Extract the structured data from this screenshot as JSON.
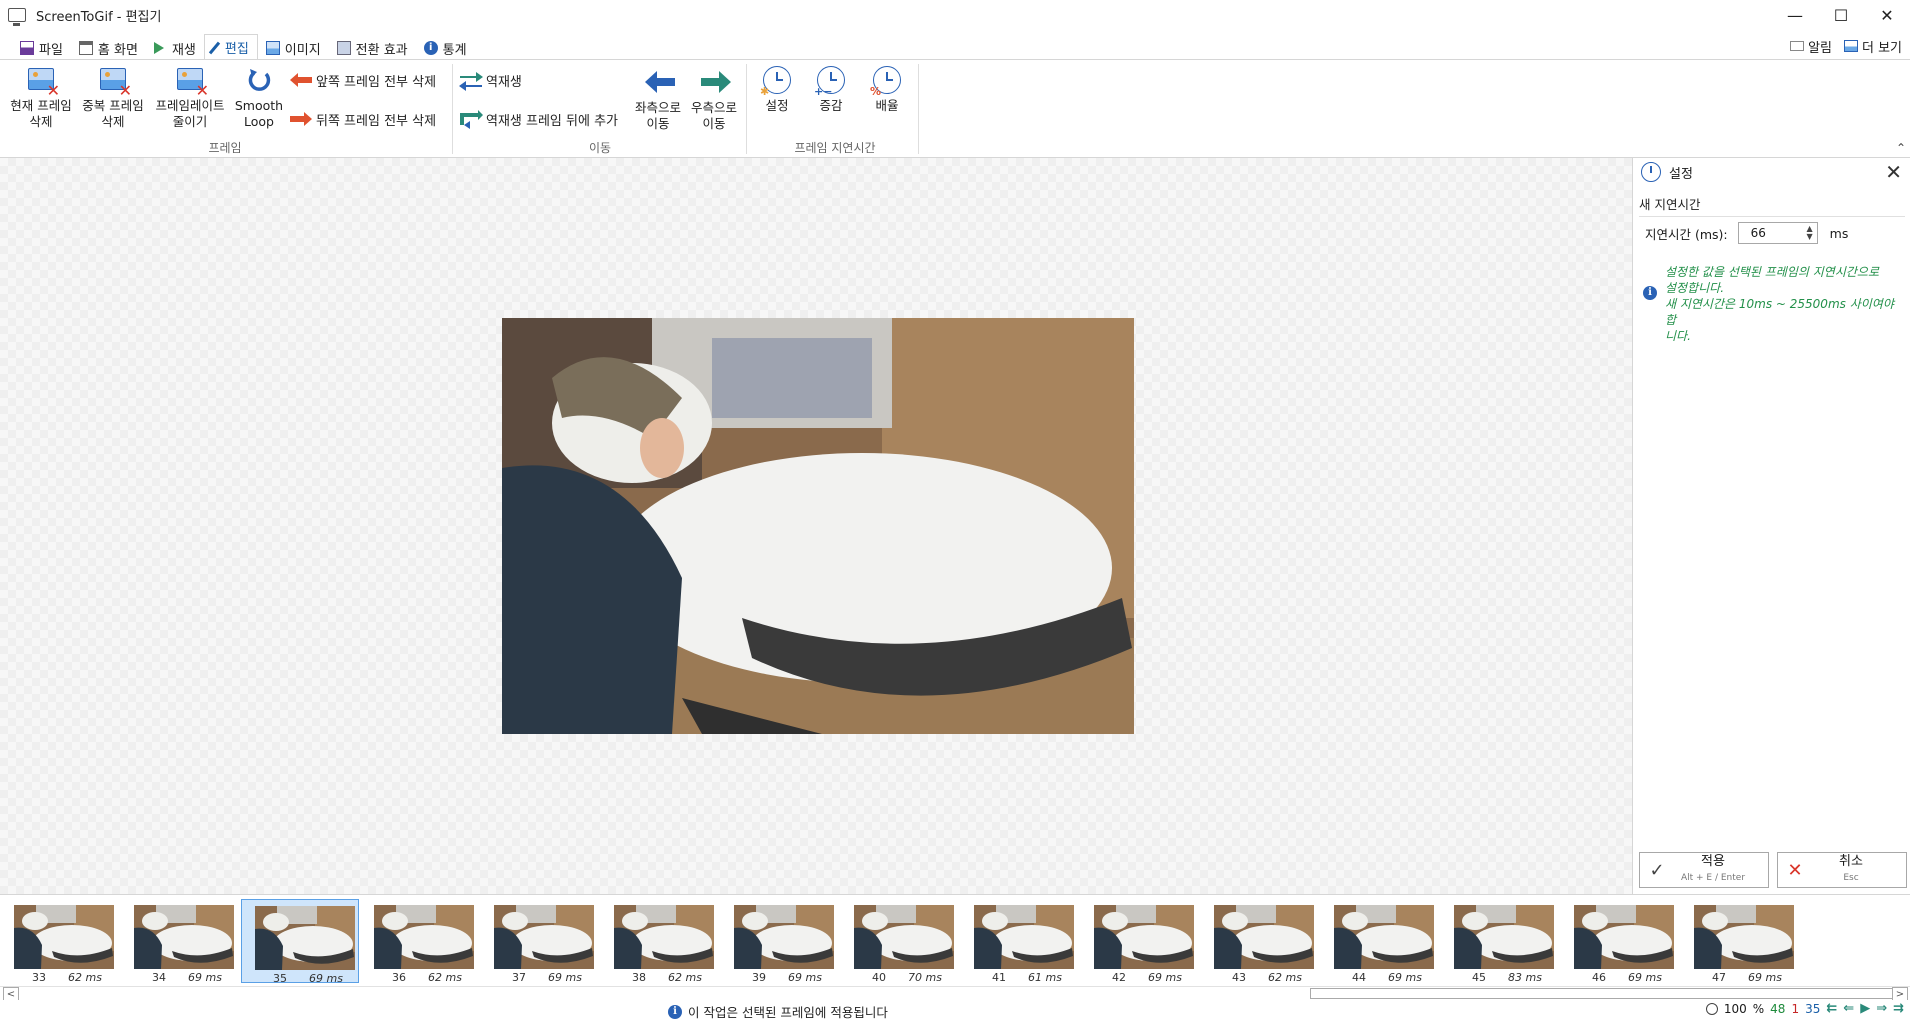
{
  "window": {
    "title": "ScreenToGif - 편집기",
    "minimize": "—",
    "maximize": "☐",
    "close": "✕"
  },
  "tabs": [
    {
      "label": "파일",
      "icon": "save-icon"
    },
    {
      "label": "홈 화면",
      "icon": "home-icon"
    },
    {
      "label": "재생",
      "icon": "play-icon"
    },
    {
      "label": "편집",
      "icon": "pencil-icon",
      "active": true
    },
    {
      "label": "이미지",
      "icon": "image-icon"
    },
    {
      "label": "전환 효과",
      "icon": "transition-icon"
    },
    {
      "label": "통계",
      "icon": "info-icon"
    }
  ],
  "tabs_right": {
    "notifications": "알림",
    "more": "더 보기"
  },
  "ribbon": {
    "frame_group": {
      "label": "프레임",
      "delete_current": [
        "현재 프레임",
        "삭제"
      ],
      "delete_duplicates": [
        "중복 프레임",
        "삭제"
      ],
      "reduce_framerate": [
        "프레임레이트",
        "줄이기"
      ],
      "smooth_loop": [
        "Smooth",
        "Loop"
      ],
      "delete_previous": "앞쪽 프레임 전부 삭제",
      "delete_next": "뒤쪽 프레임 전부 삭제"
    },
    "move_group": {
      "label": "이동",
      "reverse": "역재생",
      "yoyo": "역재생 프레임 뒤에 추가",
      "move_left": [
        "좌측으로",
        "이동"
      ],
      "move_right": [
        "우측으로",
        "이동"
      ]
    },
    "delay_group": {
      "label": "프레임 지연시간",
      "override": "설정",
      "increase_decrease": "증감",
      "scale": "배율"
    }
  },
  "panel": {
    "title": "설정",
    "section": "새 지연시간",
    "delay_label": "지연시간 (ms):",
    "delay_value": "66",
    "delay_unit": "ms",
    "info_lines": [
      "설정한 값을 선택된 프레임의 지연시간으로",
      "설정합니다.",
      "새 지연시간은 10ms ~ 25500ms 사이여야 합",
      "니다."
    ],
    "apply": {
      "label": "적용",
      "shortcut": "Alt + E / Enter"
    },
    "cancel": {
      "label": "취소",
      "shortcut": "Esc"
    }
  },
  "frames": [
    {
      "number": "33",
      "delay": "62 ms"
    },
    {
      "number": "34",
      "delay": "69 ms"
    },
    {
      "number": "35",
      "delay": "69 ms",
      "selected": true
    },
    {
      "number": "36",
      "delay": "62 ms"
    },
    {
      "number": "37",
      "delay": "69 ms"
    },
    {
      "number": "38",
      "delay": "62 ms"
    },
    {
      "number": "39",
      "delay": "69 ms"
    },
    {
      "number": "40",
      "delay": "70 ms"
    },
    {
      "number": "41",
      "delay": "61 ms"
    },
    {
      "number": "42",
      "delay": "69 ms"
    },
    {
      "number": "43",
      "delay": "62 ms"
    },
    {
      "number": "44",
      "delay": "69 ms"
    },
    {
      "number": "45",
      "delay": "83 ms"
    },
    {
      "number": "46",
      "delay": "69 ms"
    },
    {
      "number": "47",
      "delay": "69 ms"
    }
  ],
  "status": {
    "message": "이 작업은 선택된 프레임에 적용됩니다",
    "zoom": "100",
    "zoom_unit": "%",
    "total_frames": "48",
    "selected_count": "1",
    "current_frame": "35"
  },
  "colors": {
    "accent": "#1a5fa8",
    "info_text": "#23904a",
    "delete_red": "#d9352a",
    "selected_bg": "#cfe5fb"
  }
}
